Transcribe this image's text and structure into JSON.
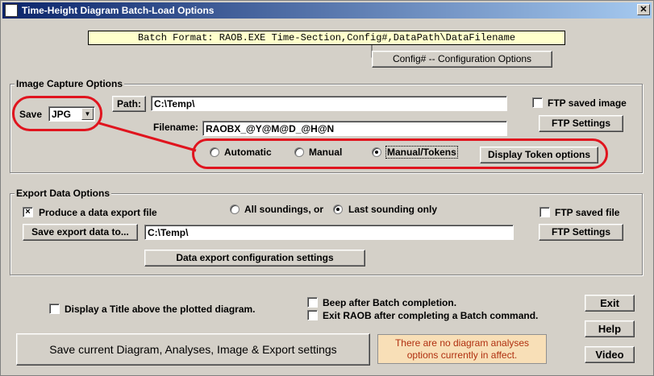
{
  "window": {
    "title": "Time-Height Diagram Batch-Load Options",
    "close_glyph": "✕"
  },
  "batch_format": "Batch Format:  RAOB.EXE Time-Section,Config#,DataPath\\DataFilename",
  "config_button": "Config# -- Configuration Options",
  "image_capture": {
    "group_title": "Image Capture Options",
    "save_label": "Save",
    "save_format": "JPG",
    "path_button": "Path:",
    "path_value": "C:\\Temp\\",
    "filename_label": "Filename:",
    "filename_value": "RAOBX_@Y@M@D_@H@N",
    "radio_automatic": "Automatic",
    "radio_manual": "Manual",
    "radio_manual_tokens": "Manual/Tokens",
    "selected_mode": "Manual/Tokens",
    "display_token_button": "Display Token options",
    "ftp_saved_image": "FTP saved image",
    "ftp_settings_button": "FTP Settings"
  },
  "export_data": {
    "group_title": "Export Data Options",
    "produce_export_label": "Produce a data export file",
    "produce_export_checked": true,
    "all_soundings_label": "All soundings, or",
    "last_sounding_label": "Last sounding only",
    "selected_sounding": "Last sounding only",
    "save_export_button": "Save export data to...",
    "export_path_value": "C:\\Temp\\",
    "ftp_saved_file": "FTP saved file",
    "ftp_settings_button": "FTP Settings",
    "config_settings_button": "Data export configuration settings"
  },
  "bottom": {
    "display_title_label": "Display a Title above the plotted diagram.",
    "beep_label": "Beep after Batch completion.",
    "exit_raob_label": "Exit RAOB after completing a Batch command.",
    "exit_button": "Exit",
    "help_button": "Help",
    "video_button": "Video",
    "save_current_button": "Save current Diagram, Analyses, Image & Export settings",
    "note_text": "There are no diagram analyses options currently in affect."
  },
  "colors": {
    "highlight_oval": "#e0141e",
    "titlebar_start": "#0a246a",
    "note_bg": "#f8dfb7"
  }
}
